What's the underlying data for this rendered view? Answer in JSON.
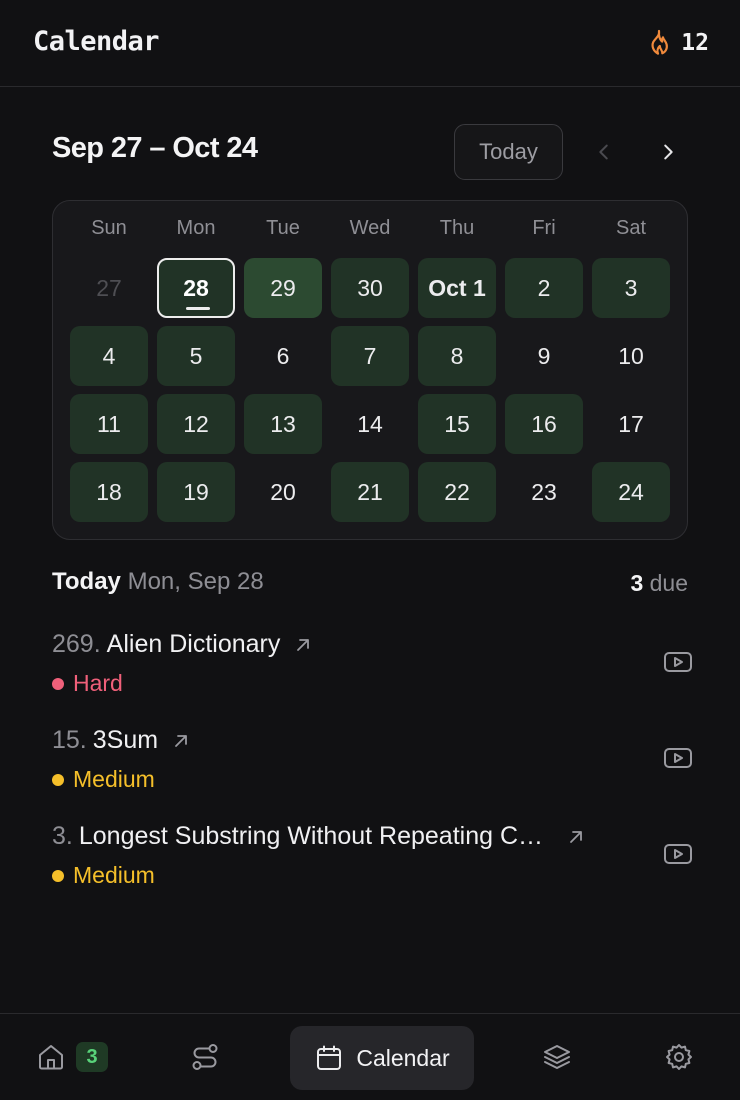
{
  "header": {
    "title": "Calendar",
    "streak": "12"
  },
  "range": {
    "title": "Sep 27 – Oct 24",
    "today_label": "Today"
  },
  "calendar": {
    "weekdays": [
      "Sun",
      "Mon",
      "Tue",
      "Wed",
      "Thu",
      "Fri",
      "Sat"
    ],
    "weeks": [
      [
        {
          "label": "27",
          "state": "muted"
        },
        {
          "label": "28",
          "state": "selected"
        },
        {
          "label": "29",
          "state": "light"
        },
        {
          "label": "30",
          "state": "has"
        },
        {
          "label": "Oct 1",
          "state": "has-bold"
        },
        {
          "label": "2",
          "state": "has"
        },
        {
          "label": "3",
          "state": "has"
        }
      ],
      [
        {
          "label": "4",
          "state": "has"
        },
        {
          "label": "5",
          "state": "has"
        },
        {
          "label": "6",
          "state": "none"
        },
        {
          "label": "7",
          "state": "has"
        },
        {
          "label": "8",
          "state": "has"
        },
        {
          "label": "9",
          "state": "none"
        },
        {
          "label": "10",
          "state": "none"
        }
      ],
      [
        {
          "label": "11",
          "state": "has"
        },
        {
          "label": "12",
          "state": "has"
        },
        {
          "label": "13",
          "state": "has"
        },
        {
          "label": "14",
          "state": "none"
        },
        {
          "label": "15",
          "state": "has"
        },
        {
          "label": "16",
          "state": "has"
        },
        {
          "label": "17",
          "state": "none"
        }
      ],
      [
        {
          "label": "18",
          "state": "has"
        },
        {
          "label": "19",
          "state": "has"
        },
        {
          "label": "20",
          "state": "none"
        },
        {
          "label": "21",
          "state": "has"
        },
        {
          "label": "22",
          "state": "has"
        },
        {
          "label": "23",
          "state": "none"
        },
        {
          "label": "24",
          "state": "has"
        }
      ]
    ]
  },
  "today": {
    "label": "Today",
    "date": "Mon, Sep 28",
    "due_count": "3",
    "due_label": "due"
  },
  "problems": [
    {
      "number": "269.",
      "name": "Alien Dictionary",
      "difficulty": "Hard"
    },
    {
      "number": "15.",
      "name": "3Sum",
      "difficulty": "Medium"
    },
    {
      "number": "3.",
      "name": "Longest Substring Without Repeating C…",
      "difficulty": "Medium"
    }
  ],
  "nav": {
    "home_badge": "3",
    "calendar_label": "Calendar"
  },
  "colors": {
    "accent_green": "#213326",
    "hard": "#F0607A",
    "medium": "#F5BF2A",
    "streak": "#F08A3C"
  }
}
